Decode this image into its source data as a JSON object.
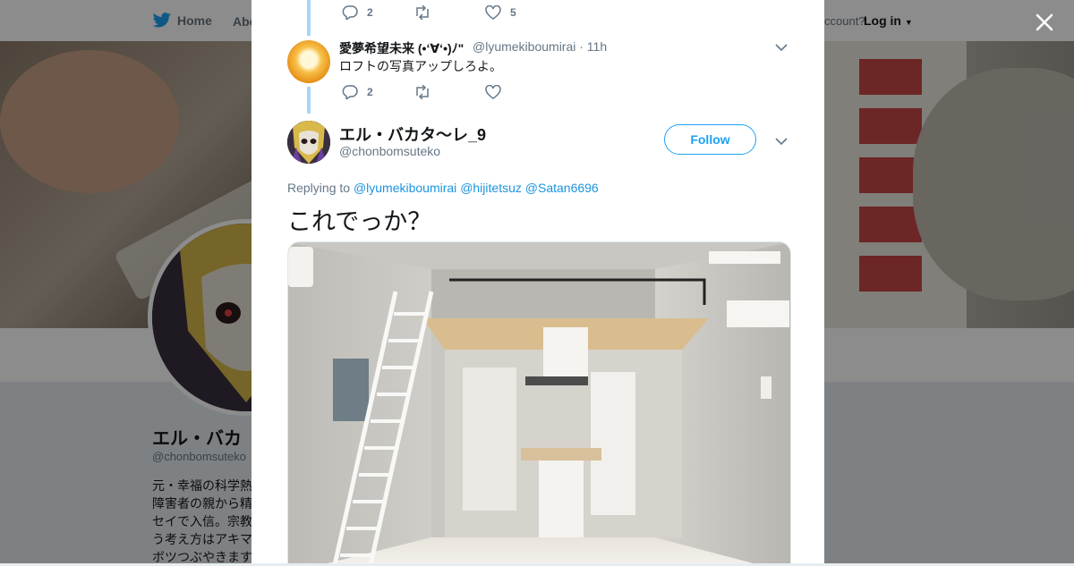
{
  "background": {
    "nav": {
      "home_label": "Home",
      "about_label": "Abo",
      "account_text": "ccount?",
      "login_label": "Log in"
    },
    "profile": {
      "name": "エル・バカ",
      "handle": "@chonbomsuteko",
      "bio_lines": [
        "元・幸福の科学熱",
        "障害者の親から精",
        "セイで入信。宗教",
        "う考え方はアキマ",
        "ボツつぶやきます"
      ]
    }
  },
  "modal": {
    "top_actions": {
      "reply_count": "2",
      "retweet_count": "",
      "like_count": "5"
    },
    "reply": {
      "name": "愛夢希望未来 (•‘∀‘•)ﾉ\"",
      "handle_time": "@lyumekiboumirai · 11h",
      "text": "ロフトの写真アップしろよ。",
      "actions": {
        "reply_count": "2",
        "retweet_count": "",
        "like_count": ""
      }
    },
    "tweet": {
      "name": "エル・バカタ～レ_9",
      "handle": "@chonbomsuteko",
      "follow_label": "Follow",
      "replying_prefix": "Replying to",
      "replying_to": [
        "@lyumekiboumirai",
        "@hijitetsuz",
        "@Satan6696"
      ],
      "text": "これでっか？"
    }
  },
  "colors": {
    "accent": "#1da1f2",
    "link": "#1b95e0",
    "thread_line": "#a5d5f5",
    "muted": "#657786"
  },
  "icons": [
    "twitter-bird-icon",
    "close-icon",
    "reply-icon",
    "retweet-icon",
    "like-icon",
    "chevron-down-icon",
    "caret-down-icon"
  ]
}
